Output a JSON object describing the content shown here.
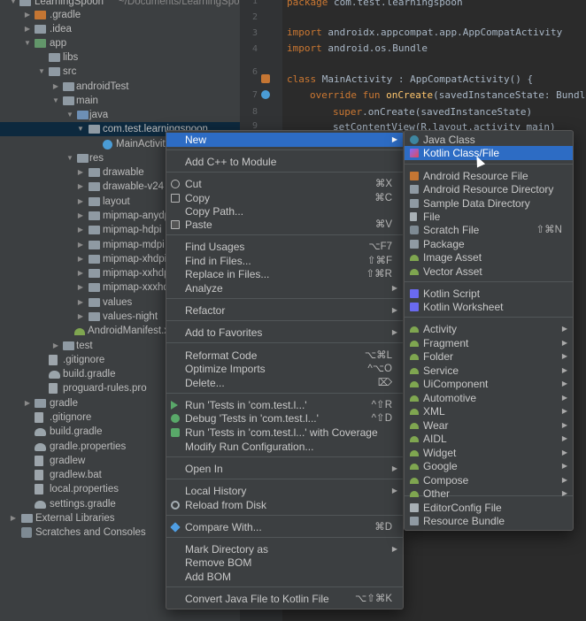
{
  "project_tree": {
    "root_title": "LearningSpoon",
    "root_path": "~/Documents/LearningSpoon",
    "items": [
      {
        "label": "LearningSpoon",
        "icon": "folder-icon"
      },
      {
        "label": ".gradle",
        "icon": "folder-icon"
      },
      {
        "label": ".idea",
        "icon": "folder-icon"
      },
      {
        "label": "app",
        "icon": "folder-icon"
      },
      {
        "label": "libs",
        "icon": "folder-icon"
      },
      {
        "label": "src",
        "icon": "folder-icon"
      },
      {
        "label": "androidTest",
        "icon": "folder-icon"
      },
      {
        "label": "main",
        "icon": "folder-icon"
      },
      {
        "label": "java",
        "icon": "folder-icon"
      },
      {
        "label": "com.test.learningspoon",
        "icon": "package-icon"
      },
      {
        "label": "MainActivity",
        "icon": "kotlin-class-icon"
      },
      {
        "label": "res",
        "icon": "folder-icon"
      },
      {
        "label": "drawable",
        "icon": "folder-icon"
      },
      {
        "label": "drawable-v24",
        "icon": "folder-icon"
      },
      {
        "label": "layout",
        "icon": "folder-icon"
      },
      {
        "label": "mipmap-anydpi",
        "icon": "folder-icon"
      },
      {
        "label": "mipmap-hdpi",
        "icon": "folder-icon"
      },
      {
        "label": "mipmap-mdpi",
        "icon": "folder-icon"
      },
      {
        "label": "mipmap-xhdpi",
        "icon": "folder-icon"
      },
      {
        "label": "mipmap-xxhdpi",
        "icon": "folder-icon"
      },
      {
        "label": "mipmap-xxxhdpi",
        "icon": "folder-icon"
      },
      {
        "label": "values",
        "icon": "folder-icon"
      },
      {
        "label": "values-night",
        "icon": "folder-icon"
      },
      {
        "label": "AndroidManifest.xml",
        "icon": "android-manifest-icon"
      },
      {
        "label": "test",
        "icon": "folder-icon"
      },
      {
        "label": ".gitignore",
        "icon": "file-icon"
      },
      {
        "label": "build.gradle",
        "icon": "gradle-icon"
      },
      {
        "label": "proguard-rules.pro",
        "icon": "file-icon"
      },
      {
        "label": "gradle",
        "icon": "folder-icon"
      },
      {
        "label": ".gitignore",
        "icon": "file-icon"
      },
      {
        "label": "build.gradle",
        "icon": "gradle-icon"
      },
      {
        "label": "gradle.properties",
        "icon": "gradle-icon"
      },
      {
        "label": "gradlew",
        "icon": "file-icon"
      },
      {
        "label": "gradlew.bat",
        "icon": "file-icon"
      },
      {
        "label": "local.properties",
        "icon": "file-icon"
      },
      {
        "label": "settings.gradle",
        "icon": "gradle-icon"
      },
      {
        "label": "External Libraries",
        "icon": "library-icon"
      },
      {
        "label": "Scratches and Consoles",
        "icon": "scratch-icon"
      }
    ]
  },
  "editor": {
    "line_numbers": [
      "1",
      "2",
      "3",
      "4",
      "5",
      "6",
      "7",
      "8",
      "9"
    ],
    "line1": {
      "kw": "package",
      "rest": " com.test.learningspoon"
    },
    "line3": {
      "kw": "import",
      "rest": " androidx.appcompat.app.AppCompatActivity"
    },
    "line4": {
      "kw": "import",
      "rest": " android.os.Bundle"
    },
    "line6": {
      "kw": "class",
      "rest": " MainActivity : AppCompatActivity() {"
    },
    "line7": {
      "kw": "override fun",
      "fn": "onCreate",
      "rest": "(savedInstanceState: Bundle"
    },
    "line8": {
      "kw": "super",
      "rest": ".onCreate(savedInstanceState)"
    },
    "line9": {
      "text": "setContentView(R.layout.activity_main)"
    }
  },
  "context_menu": {
    "items": [
      {
        "label": "New",
        "shortcut": "",
        "submenu": true,
        "active": true
      },
      {
        "label": "Add C++ to Module",
        "shortcut": ""
      },
      {
        "label": "Cut",
        "shortcut": "⌘X",
        "icon": "cut-icon"
      },
      {
        "label": "Copy",
        "shortcut": "⌘C",
        "icon": "copy-icon"
      },
      {
        "label": "Copy Path...",
        "shortcut": ""
      },
      {
        "label": "Paste",
        "shortcut": "⌘V",
        "icon": "paste-icon"
      },
      {
        "label": "Find Usages",
        "shortcut": "⌥F7"
      },
      {
        "label": "Find in Files...",
        "shortcut": "⇧⌘F"
      },
      {
        "label": "Replace in Files...",
        "shortcut": "⇧⌘R"
      },
      {
        "label": "Analyze",
        "shortcut": "",
        "submenu": true
      },
      {
        "label": "Refactor",
        "shortcut": "",
        "submenu": true
      },
      {
        "label": "Add to Favorites",
        "shortcut": "",
        "submenu": true
      },
      {
        "label": "Reformat Code",
        "shortcut": "⌥⌘L"
      },
      {
        "label": "Optimize Imports",
        "shortcut": "^⌥O"
      },
      {
        "label": "Delete...",
        "shortcut": "⌦"
      },
      {
        "label": "Run 'Tests in 'com.test.l...'",
        "shortcut": "^⇧R",
        "icon": "run-icon"
      },
      {
        "label": "Debug 'Tests in 'com.test.l...'",
        "shortcut": "^⇧D",
        "icon": "debug-icon"
      },
      {
        "label": "Run 'Tests in 'com.test.l...' with Coverage",
        "shortcut": "",
        "icon": "coverage-icon"
      },
      {
        "label": "Modify Run Configuration...",
        "shortcut": ""
      },
      {
        "label": "Open In",
        "shortcut": "",
        "submenu": true
      },
      {
        "label": "Local History",
        "shortcut": "",
        "submenu": true
      },
      {
        "label": "Reload from Disk",
        "shortcut": "",
        "icon": "reload-icon"
      },
      {
        "label": "Compare With...",
        "shortcut": "⌘D",
        "icon": "compare-icon"
      },
      {
        "label": "Mark Directory as",
        "shortcut": "",
        "submenu": true
      },
      {
        "label": "Remove BOM",
        "shortcut": ""
      },
      {
        "label": "Add BOM",
        "shortcut": ""
      },
      {
        "label": "Convert Java File to Kotlin File",
        "shortcut": "⌥⇧⌘K"
      }
    ]
  },
  "new_submenu": {
    "items": [
      {
        "label": "Java Class",
        "icon": "java-class-icon"
      },
      {
        "label": "Kotlin Class/File",
        "icon": "kotlin-file-icon",
        "active": true
      },
      {
        "label": "Android Resource File",
        "icon": "android-resource-file-icon"
      },
      {
        "label": "Android Resource Directory",
        "icon": "android-resource-directory-icon"
      },
      {
        "label": "Sample Data Directory",
        "icon": "folder-icon"
      },
      {
        "label": "File",
        "icon": "file-icon"
      },
      {
        "label": "Scratch File",
        "shortcut": "⇧⌘N",
        "icon": "scratch-file-icon"
      },
      {
        "label": "Package",
        "icon": "package-icon"
      },
      {
        "label": "Image Asset",
        "icon": "android-icon"
      },
      {
        "label": "Vector Asset",
        "icon": "android-icon"
      },
      {
        "label": "Kotlin Script",
        "icon": "kotlin-script-icon"
      },
      {
        "label": "Kotlin Worksheet",
        "icon": "kotlin-worksheet-icon"
      },
      {
        "label": "Activity",
        "icon": "android-icon",
        "submenu": true
      },
      {
        "label": "Fragment",
        "icon": "android-icon",
        "submenu": true
      },
      {
        "label": "Folder",
        "icon": "android-icon",
        "submenu": true
      },
      {
        "label": "Service",
        "icon": "android-icon",
        "submenu": true
      },
      {
        "label": "UiComponent",
        "icon": "android-icon",
        "submenu": true
      },
      {
        "label": "Automotive",
        "icon": "android-icon",
        "submenu": true
      },
      {
        "label": "XML",
        "icon": "android-icon",
        "submenu": true
      },
      {
        "label": "Wear",
        "icon": "android-icon",
        "submenu": true
      },
      {
        "label": "AIDL",
        "icon": "android-icon",
        "submenu": true
      },
      {
        "label": "Widget",
        "icon": "android-icon",
        "submenu": true
      },
      {
        "label": "Google",
        "icon": "android-icon",
        "submenu": true
      },
      {
        "label": "Compose",
        "icon": "android-icon",
        "submenu": true
      },
      {
        "label": "Other",
        "icon": "android-icon",
        "submenu": true
      },
      {
        "label": "EditorConfig File",
        "icon": "editorconfig-icon"
      },
      {
        "label": "Resource Bundle",
        "icon": "resource-bundle-icon"
      }
    ]
  },
  "colors": {
    "selection": "#2d6cc4",
    "menu_bg": "#3c3f41",
    "keyword": "#cc7832"
  }
}
